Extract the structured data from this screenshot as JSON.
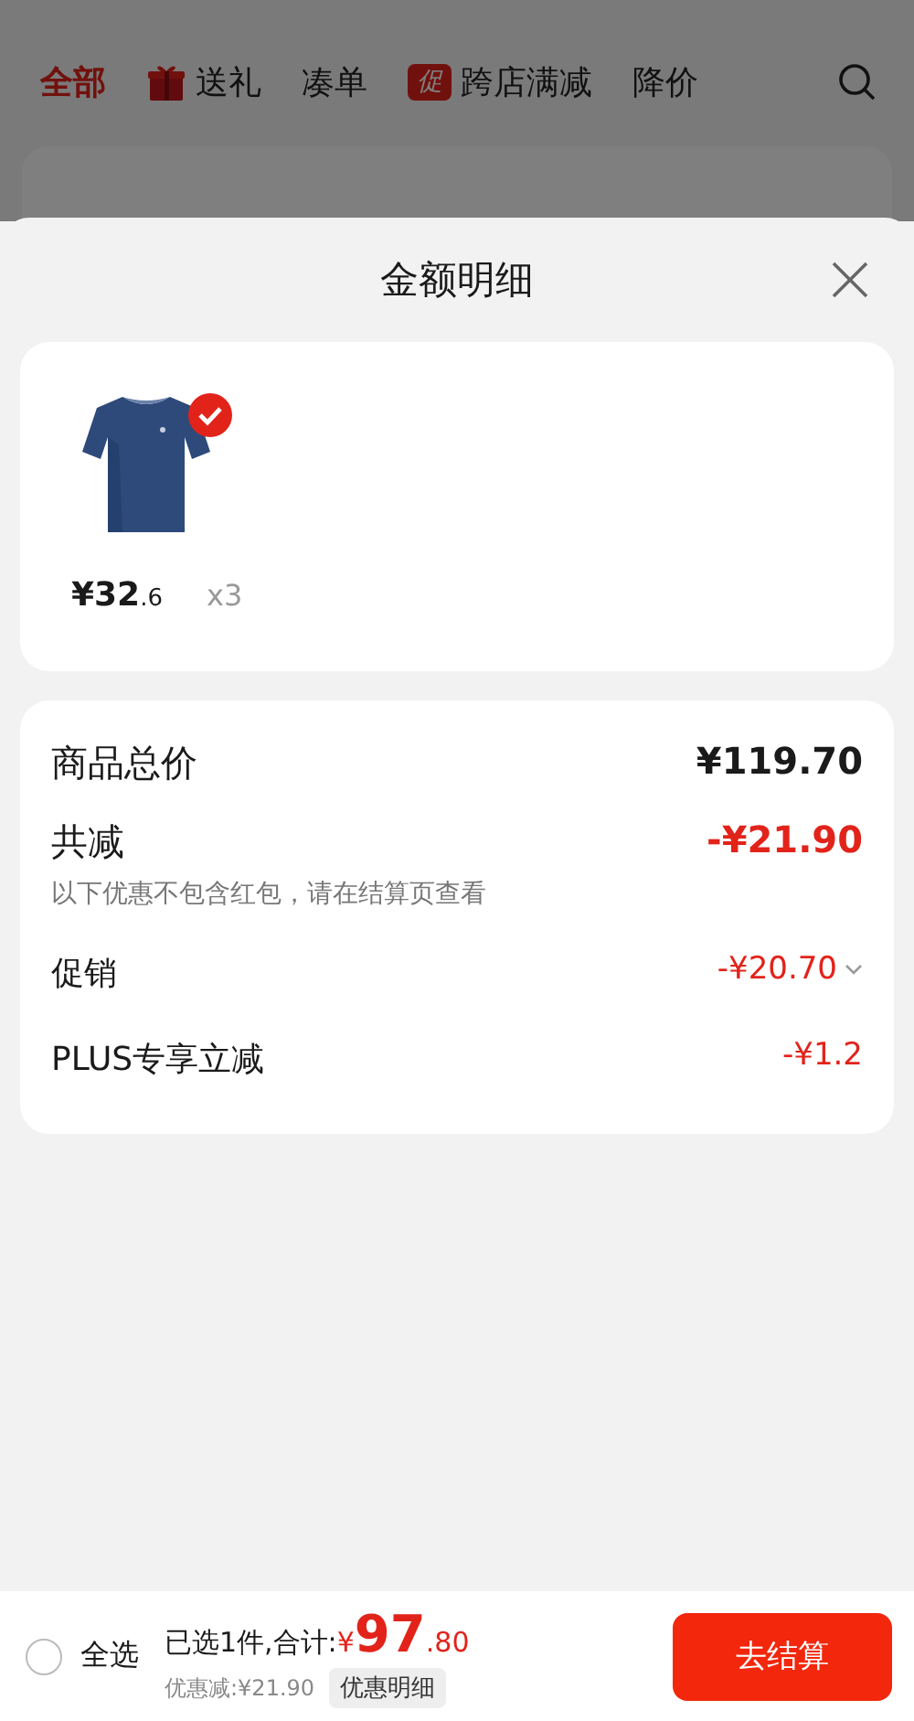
{
  "tabs": [
    {
      "label": "全部",
      "selected": true
    },
    {
      "label": "送礼",
      "selected": false,
      "kind": "gift"
    },
    {
      "label": "凑单",
      "selected": false
    },
    {
      "label": "跨店满减",
      "selected": false,
      "kind": "promo",
      "badge": "促"
    },
    {
      "label": "降价",
      "selected": false
    }
  ],
  "sheet": {
    "title": "金额明细",
    "product": {
      "kind": "picture",
      "checked": true,
      "price": "¥32",
      "price_decimal": ".6",
      "quantity": "x3"
    },
    "rows": [
      {
        "kind": "total",
        "label": "商品总价",
        "value": "¥119.70"
      },
      {
        "kind": "discount_total",
        "label": "共减",
        "value": "-¥21.90",
        "note": "以下优惠不包含红包，请在结算页查看"
      },
      {
        "kind": "item",
        "label": "促销",
        "value": "-¥20.70",
        "expandable": true
      },
      {
        "kind": "item",
        "label": "PLUS专享立减",
        "value": "-¥1.2",
        "expandable": false
      }
    ]
  },
  "bottom_bar": {
    "select_all": {
      "label": "全选",
      "checked": false
    },
    "summary": "已选1件,合计:",
    "currency": "¥",
    "total_integer": "97",
    "total_decimal": ".80",
    "saved": "优惠减:¥21.90",
    "detail_button": "优惠明细",
    "checkout": "去结算"
  }
}
